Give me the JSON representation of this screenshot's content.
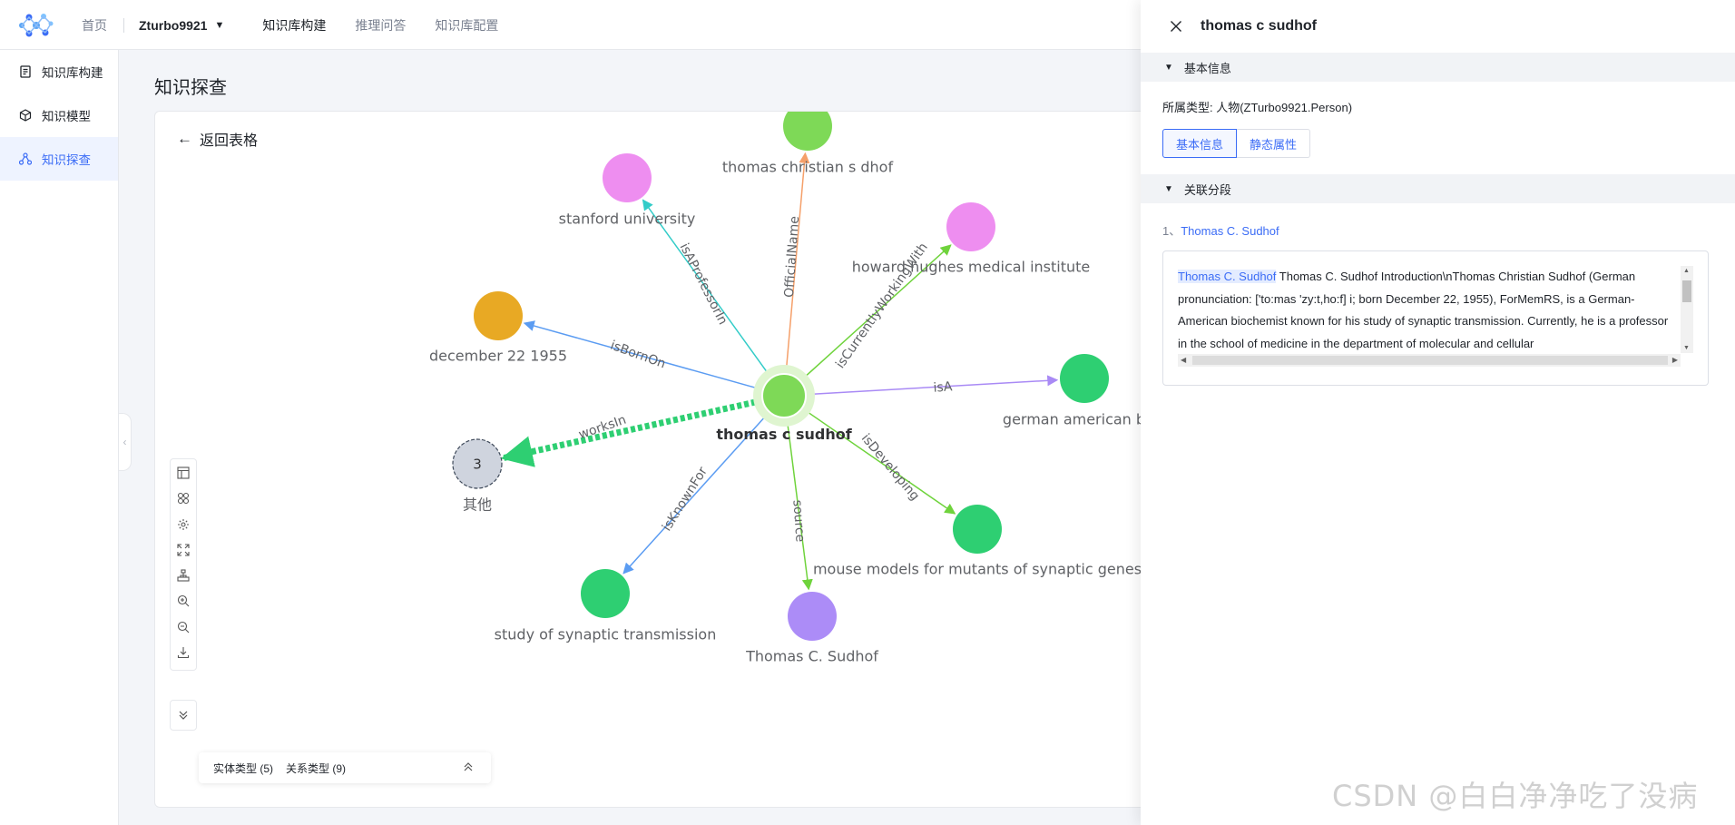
{
  "nav": {
    "home": "首页",
    "account": "Zturbo9921",
    "items": [
      "知识库构建",
      "推理问答",
      "知识库配置"
    ]
  },
  "sidebar": {
    "items": [
      {
        "label": "知识库构建",
        "icon": "document-icon"
      },
      {
        "label": "知识模型",
        "icon": "cube-icon"
      },
      {
        "label": "知识探查",
        "icon": "graph-icon",
        "active": true
      }
    ]
  },
  "page": {
    "title": "知识探查",
    "back": "返回表格"
  },
  "graph": {
    "center": {
      "label": "thomas c  sudhof",
      "color": "#7ed957"
    },
    "nodes": [
      {
        "id": "n1",
        "label": "thomas christian s dhof",
        "color": "#7ed957"
      },
      {
        "id": "n2",
        "label": "stanford university",
        "color": "#ee8ef0"
      },
      {
        "id": "n3",
        "label": "howard hughes medical institute",
        "color": "#ee8ef0"
      },
      {
        "id": "n4",
        "label": "december 22  1955",
        "color": "#e8a924"
      },
      {
        "id": "n5",
        "label": "german american bioc",
        "color": "#2ecf72"
      },
      {
        "id": "n6",
        "label": "其他",
        "color": "#cfd4de",
        "count": "3"
      },
      {
        "id": "n7",
        "label": "mouse models for mutants of synaptic genes",
        "color": "#2ecf72"
      },
      {
        "id": "n8",
        "label": "study of synaptic transmission",
        "color": "#2ecf72"
      },
      {
        "id": "n9",
        "label": "Thomas C. Sudhof",
        "color": "#ac8cf7"
      }
    ],
    "edges": [
      {
        "to": "n1",
        "label": "OfficialName",
        "color": "#f5a06a"
      },
      {
        "to": "n2",
        "label": "isAProfessorIn",
        "color": "#33ccc8"
      },
      {
        "to": "n3",
        "label": "isCurrentlyWorkingWith",
        "color": "#6fd33c"
      },
      {
        "to": "n4",
        "label": "isBornOn",
        "color": "#5b9cf2"
      },
      {
        "to": "n5",
        "label": "isA",
        "color": "#a98af5"
      },
      {
        "to": "n6",
        "label": "worksIn",
        "color": "#2ecf72"
      },
      {
        "to": "n7",
        "label": "isDeveloping",
        "color": "#6fd33c"
      },
      {
        "to": "n8",
        "label": "isKnownFor",
        "color": "#5b9cf2"
      },
      {
        "to": "n9",
        "label": "source",
        "color": "#6fd33c"
      }
    ]
  },
  "legend": {
    "entity": "实体类型 (5)",
    "relation": "关系类型 (9)"
  },
  "panel": {
    "title": "thomas c sudhof",
    "section_basic": "基本信息",
    "type_line": "所属类型: 人物(ZTurbo9921.Person)",
    "btn_basic": "基本信息",
    "btn_static": "静态属性",
    "section_segments": "关联分段",
    "segment_index": "1、",
    "segment_link": "Thomas C. Sudhof",
    "segment_highlight": "Thomas C. Sudhof",
    "segment_text": " Thomas C. Sudhof Introduction\\nThomas Christian Sudhof (German pronunciation: ['to:mas 'zy:t,ho:f] i; born December 22, 1955), ForMemRS, is a German-American biochemist known for his study of synaptic transmission. Currently, he is a professor in the school of medicine in the department of molecular and cellular"
  },
  "watermark": "CSDN @白白净净吃了没病"
}
